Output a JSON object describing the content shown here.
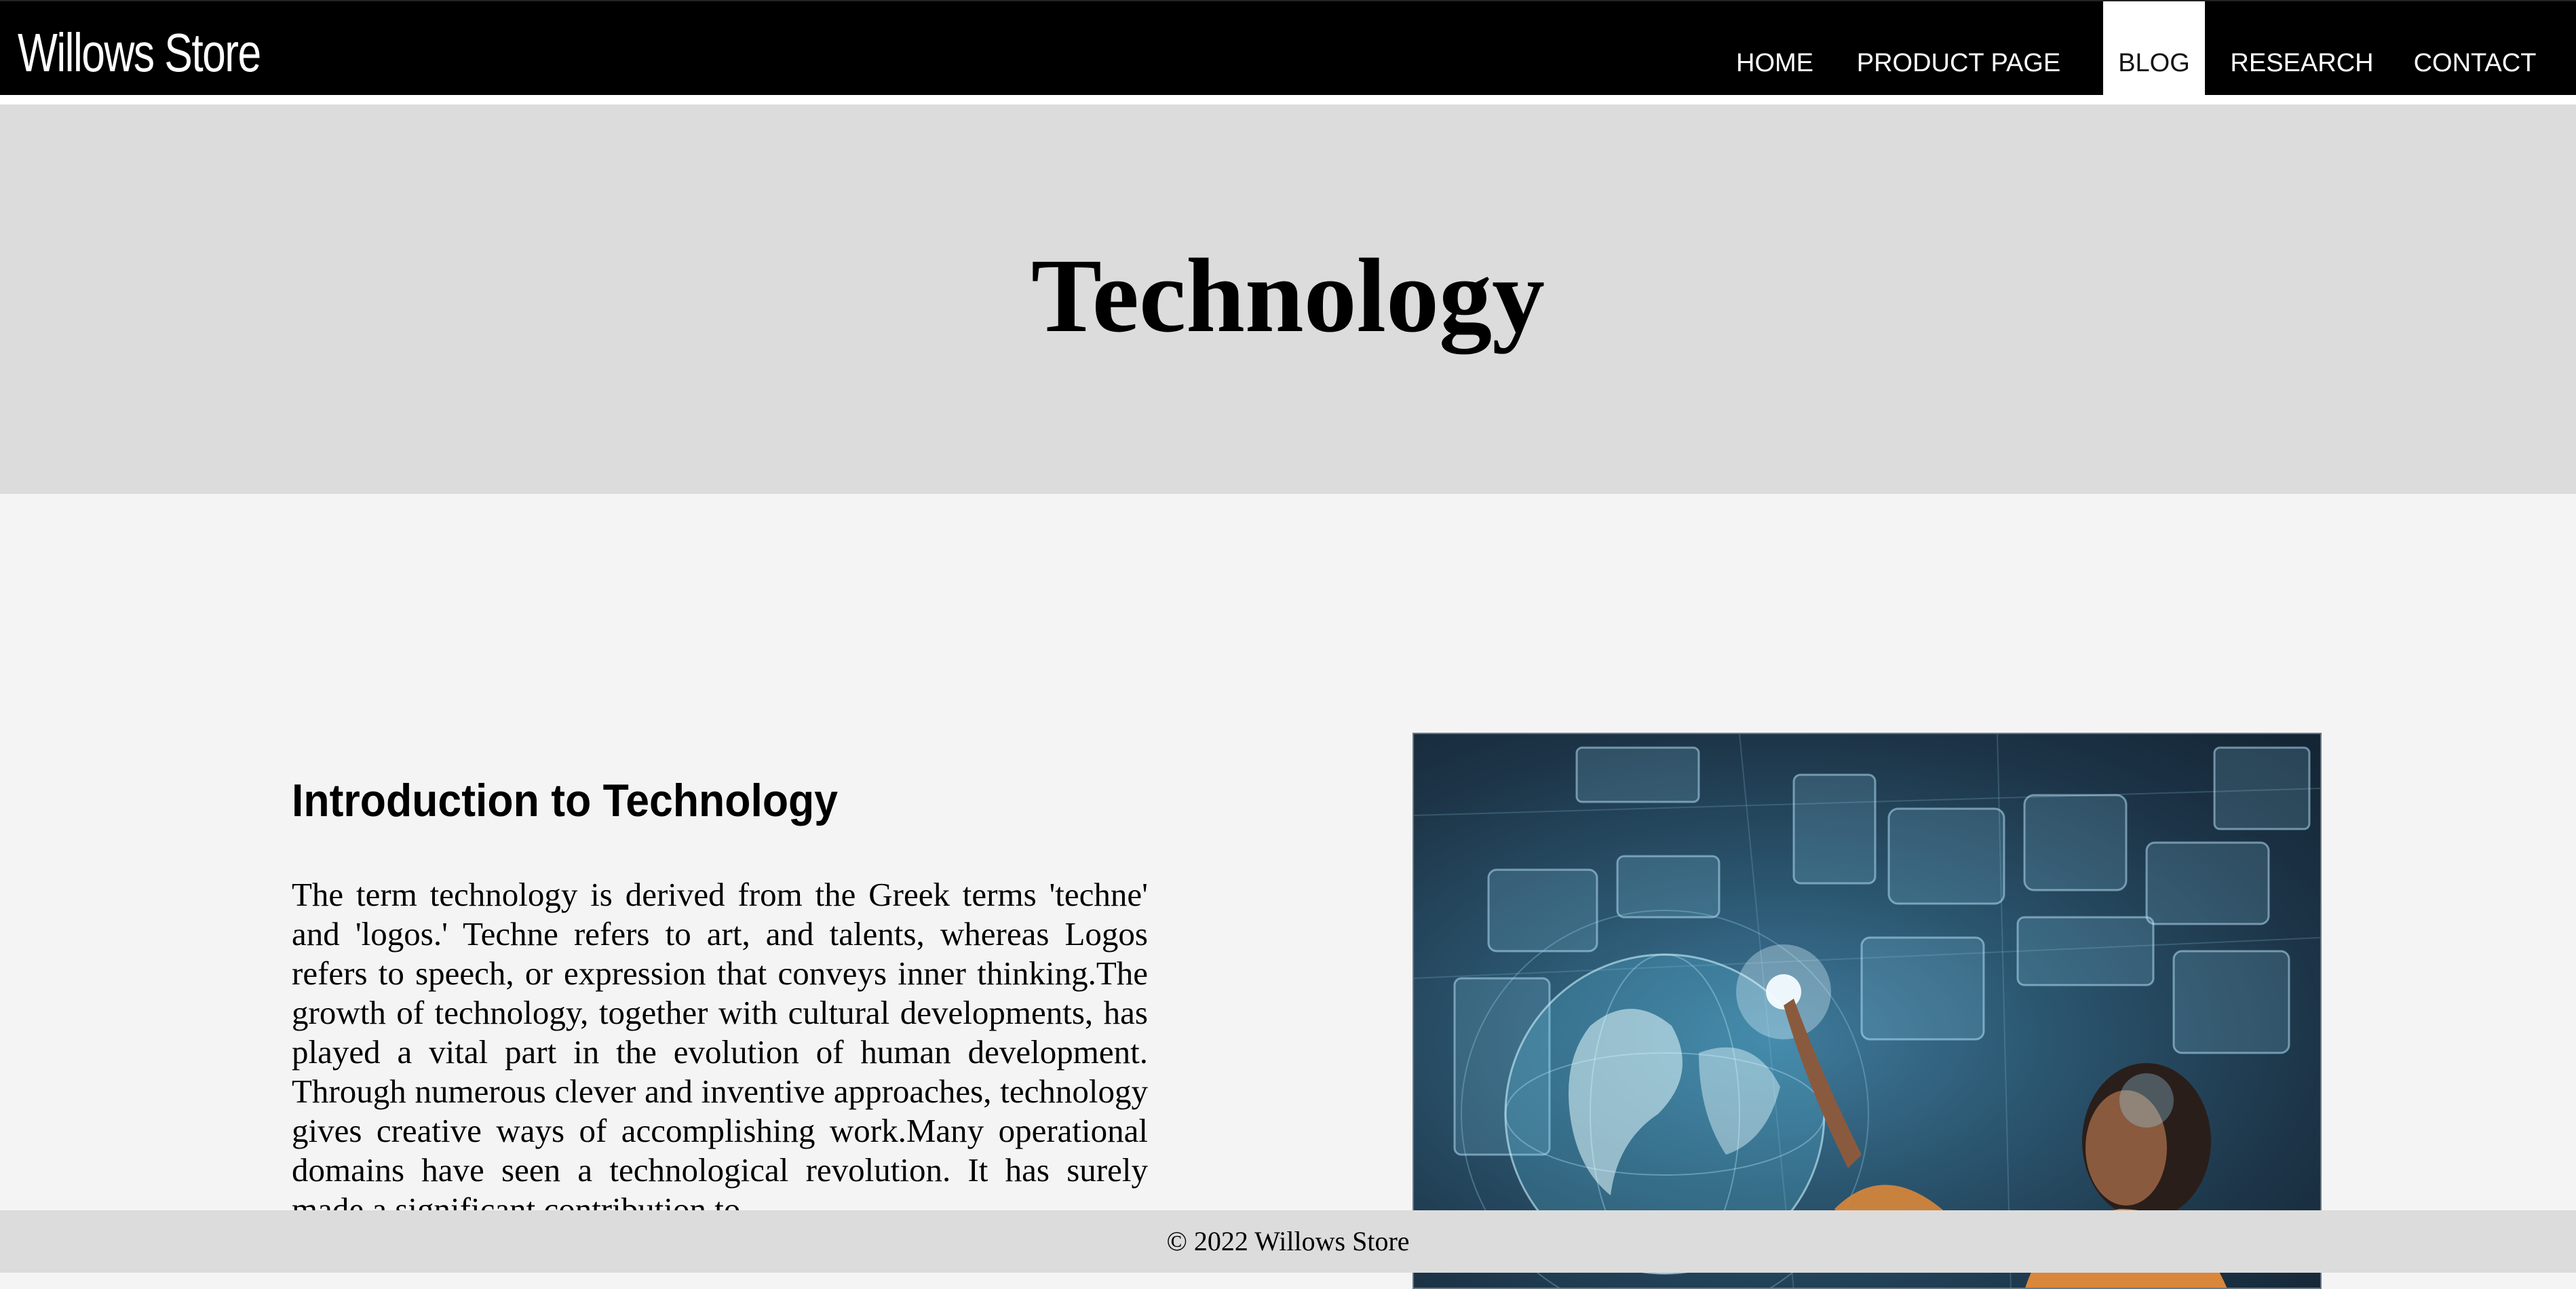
{
  "nav": {
    "logo": "Willows Store",
    "links": [
      "HOME",
      "PRODUCT PAGE",
      "BLOG",
      "RESEARCH",
      "CONTACT"
    ],
    "active": "BLOG"
  },
  "hero": {
    "title": "Technology"
  },
  "article": {
    "heading": "Introduction to Technology",
    "body": "The term technology is derived from the Greek terms 'techne' and 'logos.' Techne refers to art, and  talents, whereas Logos refers to   speech, or expression that conveys inner thinking.The growth of technology, together with cultural developments, has played a vital part in the evolution of human development. Through numerous clever and inventive approaches, technology gives creative ways of accomplishing work.Many operational domains have seen a technological revolution. It has surely made a significant contribution to"
  },
  "image": {
    "icon": "technology-hologram-image"
  },
  "footer": {
    "text": "© 2022 Willows Store"
  },
  "colors": {
    "nav_bg": "#000000",
    "hero_bg": "#dcdcdc",
    "page_bg": "#f4f4f4",
    "footer_bg": "#dcdcdc"
  }
}
